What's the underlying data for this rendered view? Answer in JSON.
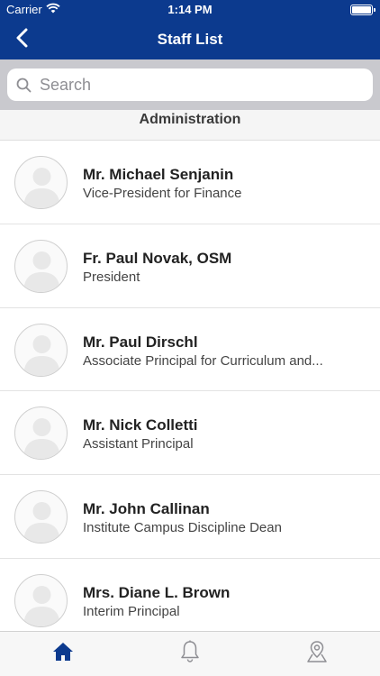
{
  "status_bar": {
    "carrier": "Carrier",
    "time": "1:14 PM"
  },
  "nav": {
    "title": "Staff List"
  },
  "search": {
    "placeholder": "Search",
    "value": ""
  },
  "section": {
    "title": "Administration"
  },
  "staff": [
    {
      "name": "Mr. Michael Senjanin",
      "role": "Vice-President for Finance"
    },
    {
      "name": "Fr. Paul Novak, OSM",
      "role": "President"
    },
    {
      "name": "Mr. Paul Dirschl",
      "role": "Associate Principal for Curriculum and..."
    },
    {
      "name": "Mr. Nick Colletti",
      "role": "Assistant Principal"
    },
    {
      "name": "Mr. John Callinan",
      "role": "Institute Campus Discipline Dean"
    },
    {
      "name": "Mrs. Diane L. Brown",
      "role": "Interim Principal"
    }
  ],
  "tabs": [
    {
      "icon": "home-icon",
      "active": true
    },
    {
      "icon": "bell-icon",
      "active": false
    },
    {
      "icon": "map-pin-icon",
      "active": false
    }
  ],
  "colors": {
    "brand_blue": "#0c3a8e",
    "search_bg": "#c9c9ce",
    "tab_active": "#0c3a8e",
    "tab_inactive": "#8e8e93"
  }
}
